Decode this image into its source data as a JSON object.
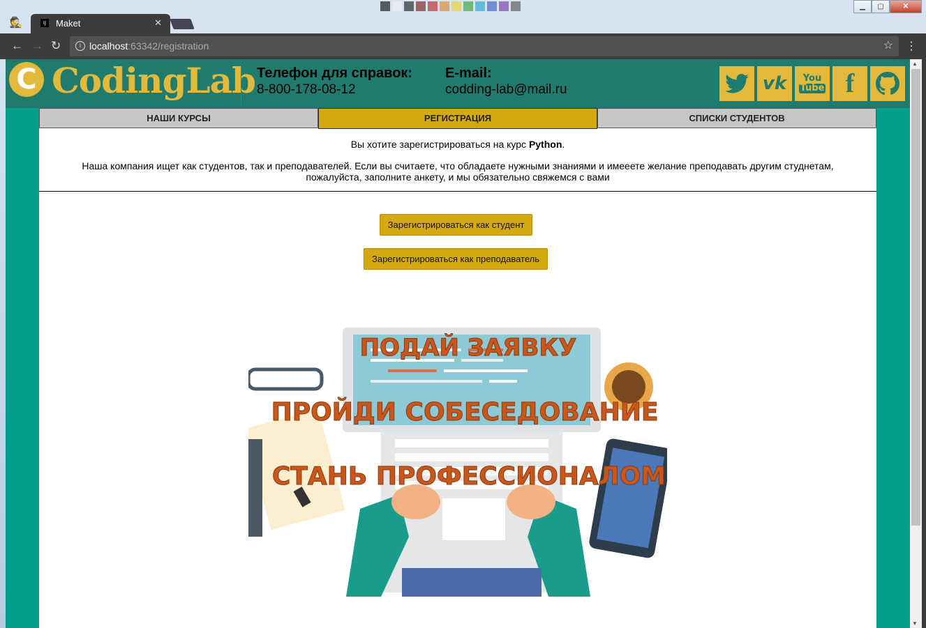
{
  "browser": {
    "tab_title": "Maket",
    "tab_close": "✕",
    "favicon_text": "IJ",
    "url_host": "localhost",
    "url_rest": ":63342/registration"
  },
  "site": {
    "logo_letter": "C",
    "logo_text": "CodingLab",
    "phone_label": "Телефон для справок:",
    "phone_value": "8-800-178-08-12",
    "email_label": "E-mail:",
    "email_value": "codding-lab@mail.ru",
    "socials": [
      {
        "icon": "twitter-icon",
        "glyph": "🐦"
      },
      {
        "icon": "vk-icon",
        "glyph": "vk"
      },
      {
        "icon": "youtube-icon",
        "glyph": "You Tube"
      },
      {
        "icon": "facebook-icon",
        "glyph": "f"
      },
      {
        "icon": "github-icon",
        "glyph": "⬤"
      }
    ],
    "colors": {
      "teal": "#05a08c",
      "header": "#1e7b6d",
      "gold": "#d4a90e"
    }
  },
  "menu": [
    {
      "label": "НАШИ КУРСЫ",
      "active": false
    },
    {
      "label": "РЕГИСТРАЦИЯ",
      "active": true
    },
    {
      "label": "СПИСКИ СТУДЕНТОВ",
      "active": false
    }
  ],
  "intro": {
    "line1_prefix": "Вы хотите зарегистрироваться на курс ",
    "course": "Python",
    "line1_suffix": ".",
    "line2": "Наша компания ищет как студентов, так и преподавателей. Если вы считаете, что обладаете нужными знаниями и имееете желание преподавать другим студнетам, пожалуйста, заполните анкету, и мы обязательно свяжемся с вами"
  },
  "buttons": {
    "student": "Зарегистрироваться как студент",
    "teacher": "Зарегистрироваться как преподаватель"
  },
  "promo": {
    "line1": "ПОДАЙ ЗАЯВКУ",
    "line2": "ПРОЙДИ СОБЕСЕДОВАНИЕ",
    "line3": "СТАНЬ ПРОФЕССИОНАЛОМ"
  }
}
